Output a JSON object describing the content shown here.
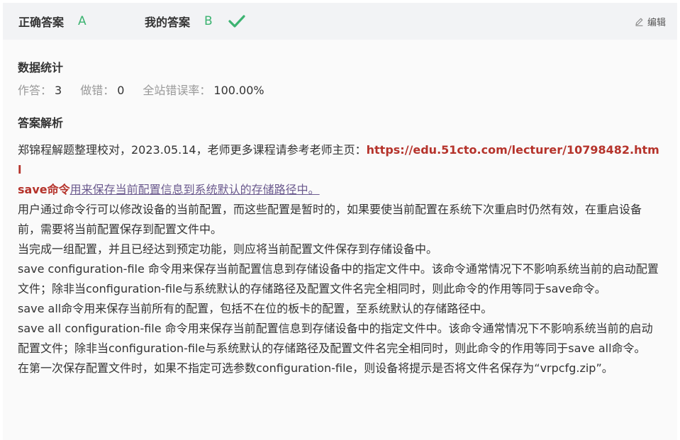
{
  "header": {
    "correct_label": "正确答案",
    "correct_value": "A",
    "mine_label": "我的答案",
    "mine_value": "B",
    "check_icon": "check-icon",
    "edit_label": "编辑",
    "edit_icon": "pencil-icon"
  },
  "stats": {
    "title": "数据统计",
    "answered_label": "作答：",
    "answered_value": "3",
    "wrong_label": "做错：",
    "wrong_value": "0",
    "rate_label": "全站错误率：",
    "rate_value": "100.00%"
  },
  "analysis": {
    "title": "答案解析",
    "intro_text": "郑锦程解题整理校对，2023.05.14，老师更多课程请参考老师主页：",
    "intro_link": "https://edu.51cto.com/lecturer/10798482.html",
    "save_cmd_bold": "save命令",
    "save_cmd_rest": "用来保存当前配置信息到系统默认的存储路径中。",
    "para1": "用户通过命令行可以修改设备的当前配置，而这些配置是暂时的，如果要使当前配置在系统下次重启时仍然有效，在重启设备前，需要将当前配置保存到配置文件中。",
    "para2": "当完成一组配置，并且已经达到预定功能，则应将当前配置文件保存到存储设备中。",
    "para3": "save configuration-file 命令用来保存当前配置信息到存储设备中的指定文件中。该命令通常情况下不影响系统当前的启动配置文件；除非当configuration-file与系统默认的存储路径及配置文件名完全相同时，则此命令的作用等同于save命令。",
    "para4": "save all命令用来保存当前所有的配置，包括不在位的板卡的配置，至系统默认的存储路径中。",
    "para5": "save all configuration-file 命令用来保存当前配置信息到存储设备中的指定文件中。该命令通常情况下不影响系统当前的启动配置文件；除非当configuration-file与系统默认的存储路径及配置文件名完全相同时，则此命令的作用等同于save all命令。",
    "para6": "在第一次保存配置文件时，如果不指定可选参数configuration-file，则设备将提示是否将文件名保存为“vrpcfg.zip”。"
  },
  "colors": {
    "accent_green": "#3cb371",
    "link_red": "#b5332b",
    "header_bg": "#f2f3f5",
    "panel_bg": "#fafafa"
  }
}
